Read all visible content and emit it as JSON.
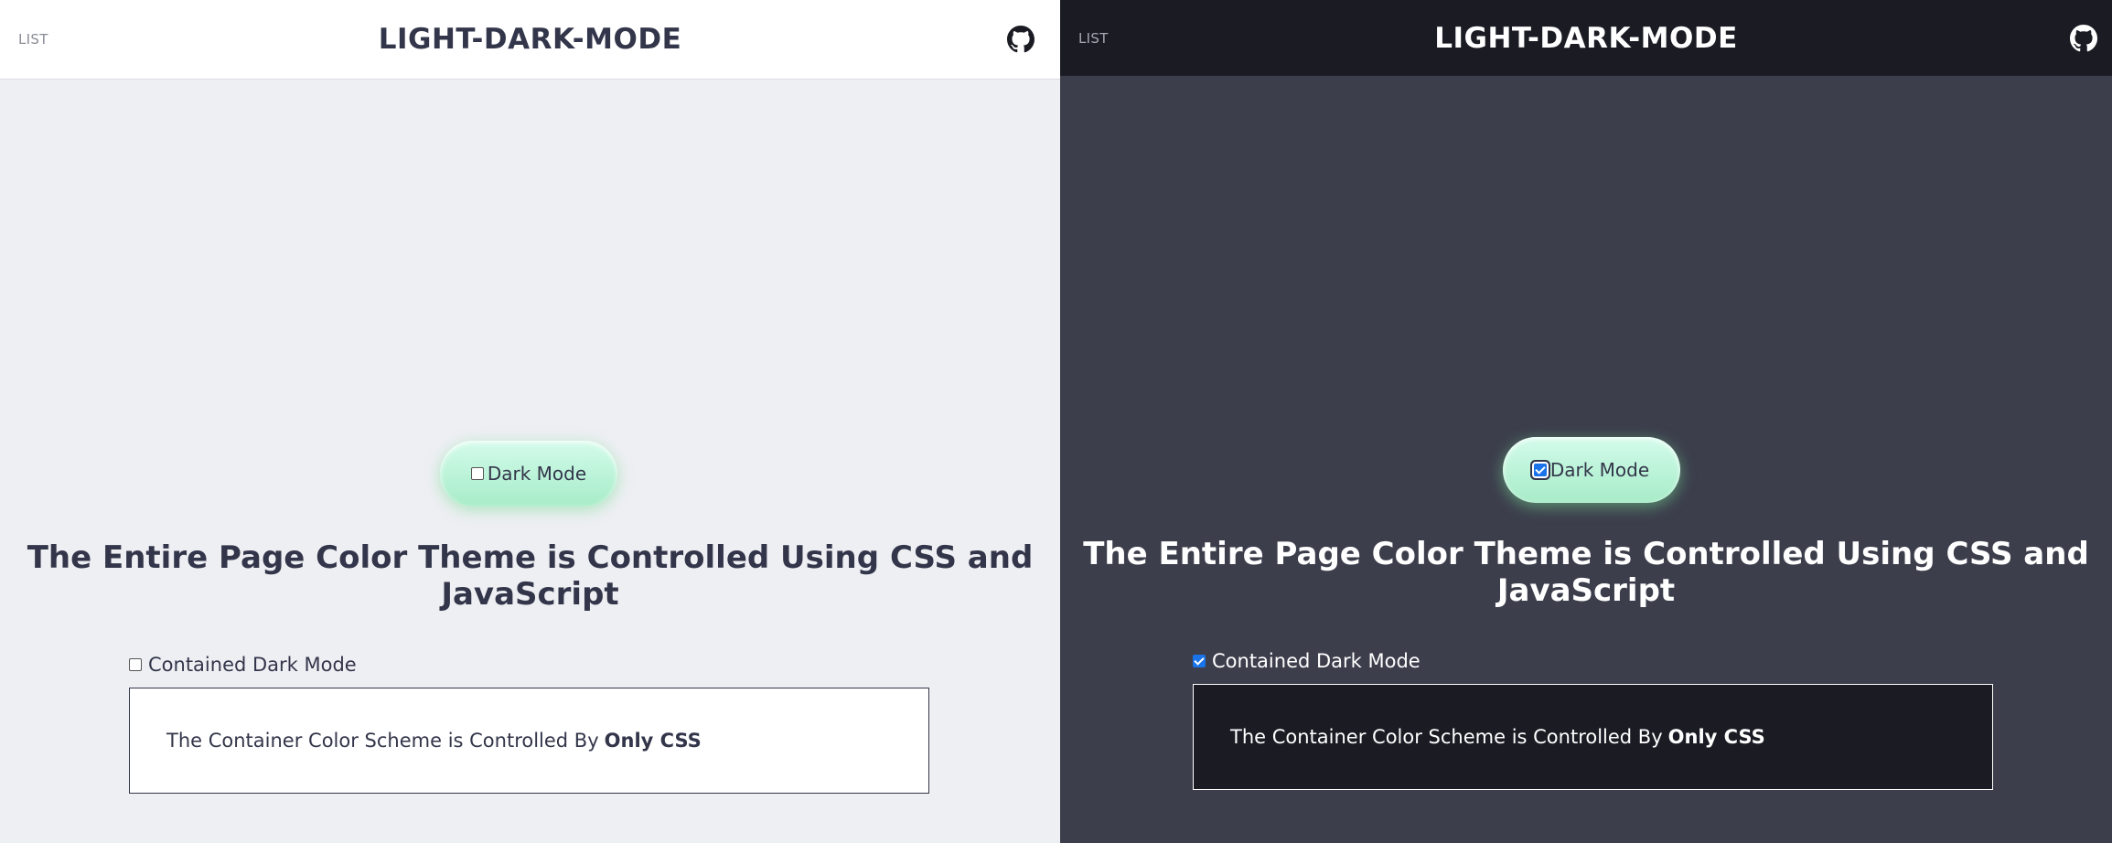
{
  "panels": [
    {
      "theme": "light",
      "header": {
        "nav_link": "LIST",
        "title": "LIGHT-DARK-MODE",
        "icon": "github-icon"
      },
      "toggle": {
        "label": "Dark Mode",
        "checked": false
      },
      "headline": "The Entire Page Color Theme is Controlled Using CSS and JavaScript",
      "contained": {
        "checkbox_label": "Contained Dark Mode",
        "checked": false,
        "text": "The Container Color Scheme is Controlled By",
        "text_bold": "Only CSS"
      }
    },
    {
      "theme": "dark",
      "header": {
        "nav_link": "LIST",
        "title": "LIGHT-DARK-MODE",
        "icon": "github-icon"
      },
      "toggle": {
        "label": "Dark Mode",
        "checked": true
      },
      "headline": "The Entire Page Color Theme is Controlled Using CSS and JavaScript",
      "contained": {
        "checkbox_label": "Contained Dark Mode",
        "checked": true,
        "text": "The Container Color Scheme is Controlled By",
        "text_bold": "Only CSS"
      }
    }
  ],
  "colors": {
    "light_bg": "#eeeff3",
    "light_header": "#ffffff",
    "dark_bg": "#3c3e4c",
    "dark_header": "#1b1b24",
    "text_dark": "#33364a",
    "toggle_green": "#b8f2d6",
    "checkbox_blue": "#1a73e8"
  }
}
